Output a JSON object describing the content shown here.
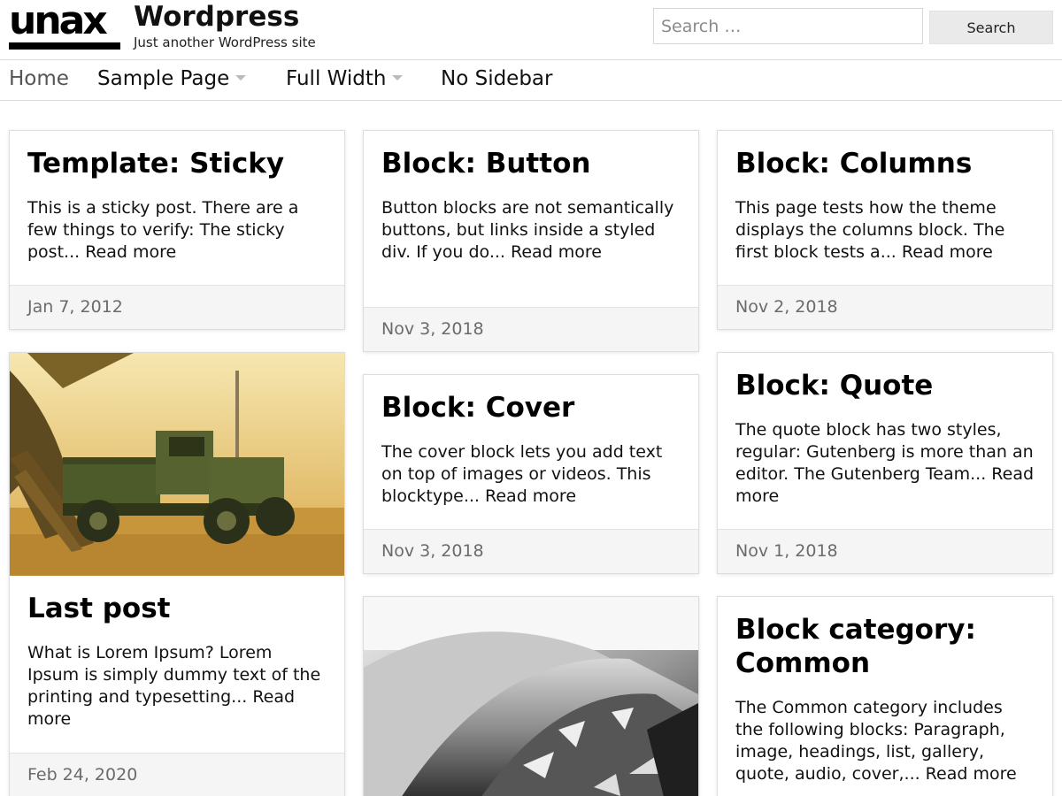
{
  "site": {
    "logo_text": "unax",
    "title": "Wordpress",
    "tagline": "Just another WordPress site"
  },
  "search": {
    "placeholder": "Search …",
    "button_label": "Search"
  },
  "nav": {
    "items": [
      {
        "label": "Home"
      },
      {
        "label": "Sample Page"
      },
      {
        "label": "Full Width"
      },
      {
        "label": "No Sidebar"
      }
    ]
  },
  "posts": [
    {
      "title": "Template: Sticky",
      "excerpt": "This is a sticky post. There are a few things to verify: The sticky post... Read more",
      "date": "Jan 7, 2012"
    },
    {
      "title": "Block: Button",
      "excerpt": "Button blocks are not semantically buttons, but links inside a styled div.  If you do... Read more",
      "date": "Nov 3, 2018"
    },
    {
      "title": "Block: Columns",
      "excerpt": "This page tests how the theme displays the columns block. The first block tests a... Read more",
      "date": "Nov 2, 2018"
    },
    {
      "title": "Last post",
      "excerpt": "What is Lorem Ipsum? Lorem Ipsum is simply dummy text of the printing and typesetting... Read more",
      "date": "Feb 24, 2020"
    },
    {
      "title": "Block: Cover",
      "excerpt": "The cover block lets you add text on top of images or videos. This blocktype... Read more",
      "date": "Nov 3, 2018"
    },
    {
      "title": "Block: Quote",
      "excerpt": "The quote block has two styles, regular: Gutenberg is more than an editor. The Gutenberg Team... Read more",
      "date": "Nov 1, 2018"
    },
    {
      "title": "Block category: Common",
      "excerpt": "The Common category includes the following blocks: Paragraph, image, headings, list, gallery, quote, audio, cover,... Read more"
    }
  ]
}
